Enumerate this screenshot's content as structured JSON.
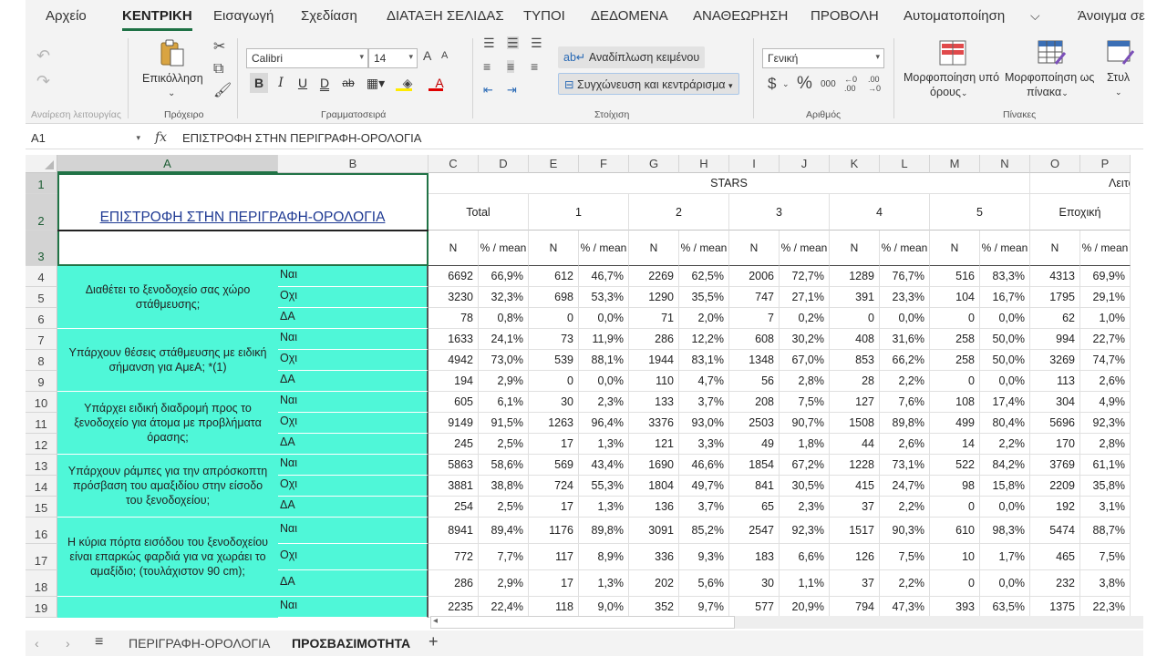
{
  "ribbon_tabs": [
    "Αρχείο",
    "ΚΕΝΤΡΙΚΗ",
    "Εισαγωγή",
    "Σχεδίαση",
    "ΔΙΑΤΑΞΗ ΣΕΛΙΔΑΣ",
    "ΤΥΠΟΙ",
    "ΔΕΔΟΜΕΝΑ",
    "ΑΝΑΘΕΩΡΗΣΗ",
    "ΠΡΟΒΟΛΗ",
    "Αυτοματοποίηση",
    "Άνοιγμα σε"
  ],
  "ribbon": {
    "undo_group": "Αναίρεση λειτουργίας",
    "clipboard_group": "Πρόχειρο",
    "paste_label": "Επικόλληση",
    "font_group": "Γραμματοσειρά",
    "font_name": "Calibri",
    "font_size": "14",
    "bold": "B",
    "italic": "I",
    "underline": "U",
    "double_underline": "D",
    "strikethrough": "ab",
    "grow_font": "A",
    "shrink_font": "A",
    "font_color": "A",
    "alignment_group": "Στοίχιση",
    "wrap_text": "Αναδίπλωση κειμένου",
    "merge_center": "Συγχώνευση και κεντράρισμα",
    "number_group": "Αριθμός",
    "number_format": "Γενική",
    "currency": "$",
    "percent": "%",
    "thousands": "000",
    "inc_decimal": "←0 .00",
    "dec_decimal": ".00 →0",
    "styles_group": "Πίνακες",
    "conditional_formatting": [
      "Μορφοποίηση υπό",
      "όρους"
    ],
    "format_as_table": [
      "Μορφοποίηση ως",
      "πίνακα"
    ],
    "cell_styles": "Στυλ"
  },
  "formula_bar": {
    "name_box": "A1",
    "fx": "fx",
    "formula": "ΕΠΙΣΤΡΟΦΗ ΣΤΗΝ ΠΕΡΙΓΡΑΦΗ-ΟΡΟΛΟΓΙΑ"
  },
  "columns": [
    "A",
    "B",
    "C",
    "D",
    "E",
    "F",
    "G",
    "H",
    "I",
    "J",
    "K",
    "L",
    "M",
    "N",
    "O",
    "P"
  ],
  "rows": [
    "1",
    "2",
    "3",
    "4",
    "5",
    "6",
    "7",
    "8",
    "9",
    "10",
    "11",
    "12",
    "13",
    "14",
    "15",
    "16",
    "17",
    "18",
    "19"
  ],
  "sheet": {
    "title_link": "ΕΠΙΣΤΡΟΦΗ ΣΤΗΝ ΠΕΡΙΓΡΑΦΗ-ΟΡΟΛΟΓΙΑ",
    "stars_header": "STARS",
    "right_header": "Λειτουρ",
    "group_headers": [
      "Total",
      "1",
      "2",
      "3",
      "4",
      "5",
      "Εποχική"
    ],
    "sub_n": "N",
    "sub_pct": "% / mean",
    "questions": [
      "Διαθέτει το ξενοδοχείο σας χώρο στάθμευσης;",
      "Υπάρχουν θέσεις στάθμευσης με ειδική σήμανση για ΑμεΑ; *(1)",
      "Υπάρχει ειδική διαδρομή προς το ξενοδοχείο για άτομα με προβλήματα όρασης;",
      "Υπάρχουν ράμπες για την απρόσκοπτη πρόσβαση του αμαξιδίου στην είσοδο του ξενοδοχείου;",
      "Η κύρια πόρτα εισόδου του ξενοδοχείου είναι επαρκώς φαρδιά για να χωράει το αμαξίδιο; (τουλάχιστον 90 cm);"
    ],
    "answers": [
      "Ναι",
      "Οχι",
      "ΔΑ",
      "Ναι",
      "Οχι",
      "ΔΑ",
      "Ναι",
      "Οχι",
      "ΔΑ",
      "Ναι",
      "Οχι",
      "ΔΑ",
      "Ναι",
      "Οχι",
      "ΔΑ",
      "Ναι"
    ],
    "data": [
      [
        "6692",
        "66,9%",
        "612",
        "46,7%",
        "2269",
        "62,5%",
        "2006",
        "72,7%",
        "1289",
        "76,7%",
        "516",
        "83,3%",
        "4313",
        "69,9%"
      ],
      [
        "3230",
        "32,3%",
        "698",
        "53,3%",
        "1290",
        "35,5%",
        "747",
        "27,1%",
        "391",
        "23,3%",
        "104",
        "16,7%",
        "1795",
        "29,1%"
      ],
      [
        "78",
        "0,8%",
        "0",
        "0,0%",
        "71",
        "2,0%",
        "7",
        "0,2%",
        "0",
        "0,0%",
        "0",
        "0,0%",
        "62",
        "1,0%"
      ],
      [
        "1633",
        "24,1%",
        "73",
        "11,9%",
        "286",
        "12,2%",
        "608",
        "30,2%",
        "408",
        "31,6%",
        "258",
        "50,0%",
        "994",
        "22,7%"
      ],
      [
        "4942",
        "73,0%",
        "539",
        "88,1%",
        "1944",
        "83,1%",
        "1348",
        "67,0%",
        "853",
        "66,2%",
        "258",
        "50,0%",
        "3269",
        "74,7%"
      ],
      [
        "194",
        "2,9%",
        "0",
        "0,0%",
        "110",
        "4,7%",
        "56",
        "2,8%",
        "28",
        "2,2%",
        "0",
        "0,0%",
        "113",
        "2,6%"
      ],
      [
        "605",
        "6,1%",
        "30",
        "2,3%",
        "133",
        "3,7%",
        "208",
        "7,5%",
        "127",
        "7,6%",
        "108",
        "17,4%",
        "304",
        "4,9%"
      ],
      [
        "9149",
        "91,5%",
        "1263",
        "96,4%",
        "3376",
        "93,0%",
        "2503",
        "90,7%",
        "1508",
        "89,8%",
        "499",
        "80,4%",
        "5696",
        "92,3%"
      ],
      [
        "245",
        "2,5%",
        "17",
        "1,3%",
        "121",
        "3,3%",
        "49",
        "1,8%",
        "44",
        "2,6%",
        "14",
        "2,2%",
        "170",
        "2,8%"
      ],
      [
        "5863",
        "58,6%",
        "569",
        "43,4%",
        "1690",
        "46,6%",
        "1854",
        "67,2%",
        "1228",
        "73,1%",
        "522",
        "84,2%",
        "3769",
        "61,1%"
      ],
      [
        "3881",
        "38,8%",
        "724",
        "55,3%",
        "1804",
        "49,7%",
        "841",
        "30,5%",
        "415",
        "24,7%",
        "98",
        "15,8%",
        "2209",
        "35,8%"
      ],
      [
        "254",
        "2,5%",
        "17",
        "1,3%",
        "136",
        "3,7%",
        "65",
        "2,3%",
        "37",
        "2,2%",
        "0",
        "0,0%",
        "192",
        "3,1%"
      ],
      [
        "8941",
        "89,4%",
        "1176",
        "89,8%",
        "3091",
        "85,2%",
        "2547",
        "92,3%",
        "1517",
        "90,3%",
        "610",
        "98,3%",
        "5474",
        "88,7%"
      ],
      [
        "772",
        "7,7%",
        "117",
        "8,9%",
        "336",
        "9,3%",
        "183",
        "6,6%",
        "126",
        "7,5%",
        "10",
        "1,7%",
        "465",
        "7,5%"
      ],
      [
        "286",
        "2,9%",
        "17",
        "1,3%",
        "202",
        "5,6%",
        "30",
        "1,1%",
        "37",
        "2,2%",
        "0",
        "0,0%",
        "232",
        "3,8%"
      ],
      [
        "2235",
        "22,4%",
        "118",
        "9,0%",
        "352",
        "9,7%",
        "577",
        "20,9%",
        "794",
        "47,3%",
        "393",
        "63,5%",
        "1375",
        "22,3%"
      ]
    ]
  },
  "sheet_tabs": [
    "ΠΕΡΙΓΡΑΦΗ-ΟΡΟΛΟΓΙΑ",
    "ΠΡΟΣΒΑΣΙΜΟΤΗΤΑ"
  ],
  "active_sheet": "ΠΡΟΣΒΑΣΙΜΟΤΗΤΑ",
  "sheet_nav": {
    "prev": "‹",
    "next": "›",
    "all_sheets": "≡",
    "add": "+"
  },
  "colors": {
    "accent": "#217346",
    "teal_fill": "#4ff7d8",
    "title_link": "#1f3a93"
  }
}
